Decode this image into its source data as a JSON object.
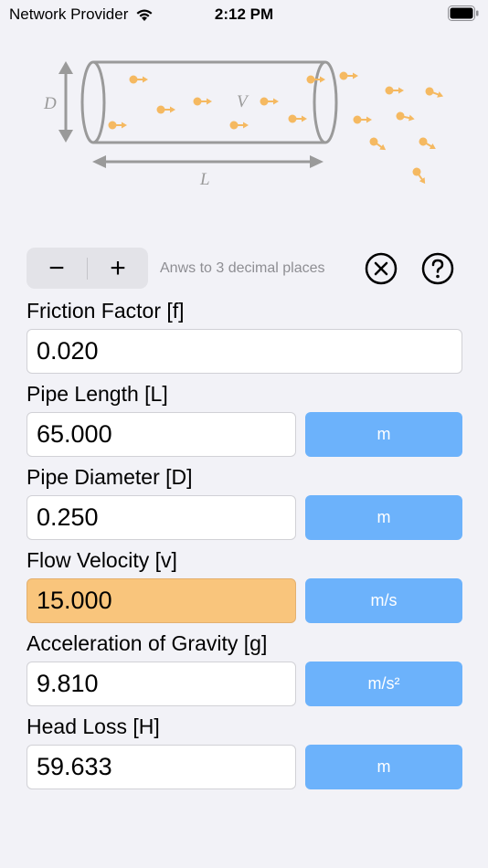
{
  "status": {
    "carrier": "Network Provider",
    "time": "2:12 PM"
  },
  "diagram": {
    "d_label": "D",
    "v_label": "V",
    "l_label": "L"
  },
  "controls": {
    "minus": "−",
    "plus": "+",
    "hint": "Anws to 3 decimal places"
  },
  "fields": [
    {
      "label": "Friction Factor [f]",
      "value": "0.020",
      "unit": ""
    },
    {
      "label": "Pipe Length [L]",
      "value": "65.000",
      "unit": "m"
    },
    {
      "label": "Pipe Diameter [D]",
      "value": "0.250",
      "unit": "m"
    },
    {
      "label": "Flow Velocity [v]",
      "value": "15.000",
      "unit": "m/s"
    },
    {
      "label": "Acceleration of Gravity [g]",
      "value": "9.810",
      "unit": "m/s²"
    },
    {
      "label": "Head Loss [H]",
      "value": "59.633",
      "unit": "m"
    }
  ],
  "colors": {
    "accent": "#6cb2fb",
    "highlight": "#f9c57c",
    "particle": "#f5b961"
  }
}
